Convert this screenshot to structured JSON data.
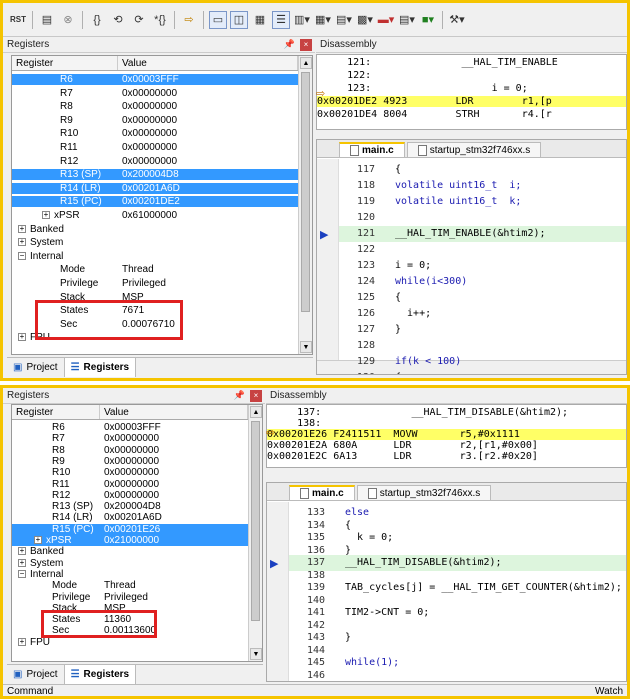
{
  "s1": {
    "registers_title": "Registers",
    "disassembly_title": "Disassembly",
    "col_register": "Register",
    "col_value": "Value",
    "rows": [
      {
        "name": "R6",
        "value": "0x00003FFF",
        "sel": true
      },
      {
        "name": "R7",
        "value": "0x00000000"
      },
      {
        "name": "R8",
        "value": "0x00000000"
      },
      {
        "name": "R9",
        "value": "0x00000000"
      },
      {
        "name": "R10",
        "value": "0x00000000"
      },
      {
        "name": "R11",
        "value": "0x00000000"
      },
      {
        "name": "R12",
        "value": "0x00000000"
      },
      {
        "name": "R13 (SP)",
        "value": "0x200004D8",
        "sel": true
      },
      {
        "name": "R14 (LR)",
        "value": "0x00201A6D",
        "sel": true
      },
      {
        "name": "R15 (PC)",
        "value": "0x00201DE2",
        "sel": true
      },
      {
        "name": "xPSR",
        "value": "0x61000000"
      },
      {
        "name": "Banked",
        "value": ""
      },
      {
        "name": "System",
        "value": ""
      },
      {
        "name": "Internal",
        "value": ""
      },
      {
        "name": "Mode",
        "value": "Thread"
      },
      {
        "name": "Privilege",
        "value": "Privileged"
      },
      {
        "name": "Stack",
        "value": "MSP"
      },
      {
        "name": "States",
        "value": "7671"
      },
      {
        "name": "Sec",
        "value": "0.00076710"
      },
      {
        "name": "FPU",
        "value": ""
      }
    ],
    "dis": [
      {
        "t": "     121:               __HAL_TIM_ENABLE"
      },
      {
        "t": "     122:"
      },
      {
        "t": "     123:                    i = 0;"
      },
      {
        "t": "0x00201DE2 4923        LDR        r1,[p",
        "cur": true
      },
      {
        "t": "0x00201DE4 8004        STRH       r4.[r"
      }
    ],
    "tab_main": "main.c",
    "tab_startup": "startup_stm32f746xx.s",
    "code": [
      {
        "ln": "117",
        "c": "{"
      },
      {
        "ln": "118",
        "c": "volatile uint16_t  i;"
      },
      {
        "ln": "119",
        "c": "volatile uint16_t  k;"
      },
      {
        "ln": "120",
        "c": ""
      },
      {
        "ln": "121",
        "c": "__HAL_TIM_ENABLE(&htim2);"
      },
      {
        "ln": "122",
        "c": ""
      },
      {
        "ln": "123",
        "c": "i = 0;"
      },
      {
        "ln": "124",
        "c": "while(i<300)"
      },
      {
        "ln": "125",
        "c": "{"
      },
      {
        "ln": "126",
        "c": "  i++;"
      },
      {
        "ln": "127",
        "c": "}"
      },
      {
        "ln": "128",
        "c": ""
      },
      {
        "ln": "129",
        "c": "if(k < 100)"
      },
      {
        "ln": "130",
        "c": "{"
      }
    ],
    "tab_project": "Project",
    "tab_registers": "Registers"
  },
  "s2": {
    "registers_title": "Registers",
    "disassembly_title": "Disassembly",
    "col_register": "Register",
    "col_value": "Value",
    "rows": [
      {
        "name": "R6",
        "value": "0x00003FFF"
      },
      {
        "name": "R7",
        "value": "0x00000000"
      },
      {
        "name": "R8",
        "value": "0x00000000"
      },
      {
        "name": "R9",
        "value": "0x00000000"
      },
      {
        "name": "R10",
        "value": "0x00000000"
      },
      {
        "name": "R11",
        "value": "0x00000000"
      },
      {
        "name": "R12",
        "value": "0x00000000"
      },
      {
        "name": "R13 (SP)",
        "value": "0x200004D8"
      },
      {
        "name": "R14 (LR)",
        "value": "0x00201A6D"
      },
      {
        "name": "R15 (PC)",
        "value": "0x00201E26",
        "sel": true
      },
      {
        "name": "xPSR",
        "value": "0x21000000",
        "sel": true
      },
      {
        "name": "Banked",
        "value": ""
      },
      {
        "name": "System",
        "value": ""
      },
      {
        "name": "Internal",
        "value": ""
      },
      {
        "name": "Mode",
        "value": "Thread"
      },
      {
        "name": "Privilege",
        "value": "Privileged"
      },
      {
        "name": "Stack",
        "value": "MSP"
      },
      {
        "name": "States",
        "value": "11360"
      },
      {
        "name": "Sec",
        "value": "0.00113600"
      },
      {
        "name": "FPU",
        "value": ""
      }
    ],
    "dis": [
      {
        "t": "     137:               __HAL_TIM_DISABLE(&htim2);"
      },
      {
        "t": "     138:"
      },
      {
        "t": "0x00201E26 F2411511  MOVW       r5,#0x1111",
        "cur": true
      },
      {
        "t": "0x00201E2A 680A      LDR        r2,[r1,#0x00]"
      },
      {
        "t": "0x00201E2C 6A13      LDR        r3.[r2.#0x20]"
      }
    ],
    "tab_main": "main.c",
    "tab_startup": "startup_stm32f746xx.s",
    "code": [
      {
        "ln": "133",
        "c": "else"
      },
      {
        "ln": "134",
        "c": "{"
      },
      {
        "ln": "135",
        "c": "  k = 0;"
      },
      {
        "ln": "136",
        "c": "}"
      },
      {
        "ln": "137",
        "c": "__HAL_TIM_DISABLE(&htim2);"
      },
      {
        "ln": "138",
        "c": ""
      },
      {
        "ln": "139",
        "c": "TAB_cycles[j] = __HAL_TIM_GET_COUNTER(&htim2);"
      },
      {
        "ln": "140",
        "c": ""
      },
      {
        "ln": "141",
        "c": "TIM2->CNT = 0;"
      },
      {
        "ln": "142",
        "c": ""
      },
      {
        "ln": "143",
        "c": "}"
      },
      {
        "ln": "144",
        "c": ""
      },
      {
        "ln": "145",
        "c": "while(1);"
      },
      {
        "ln": "146",
        "c": ""
      }
    ],
    "tab_project": "Project",
    "tab_registers": "Registers",
    "command_label": "Command",
    "watch_label": "Watch"
  }
}
